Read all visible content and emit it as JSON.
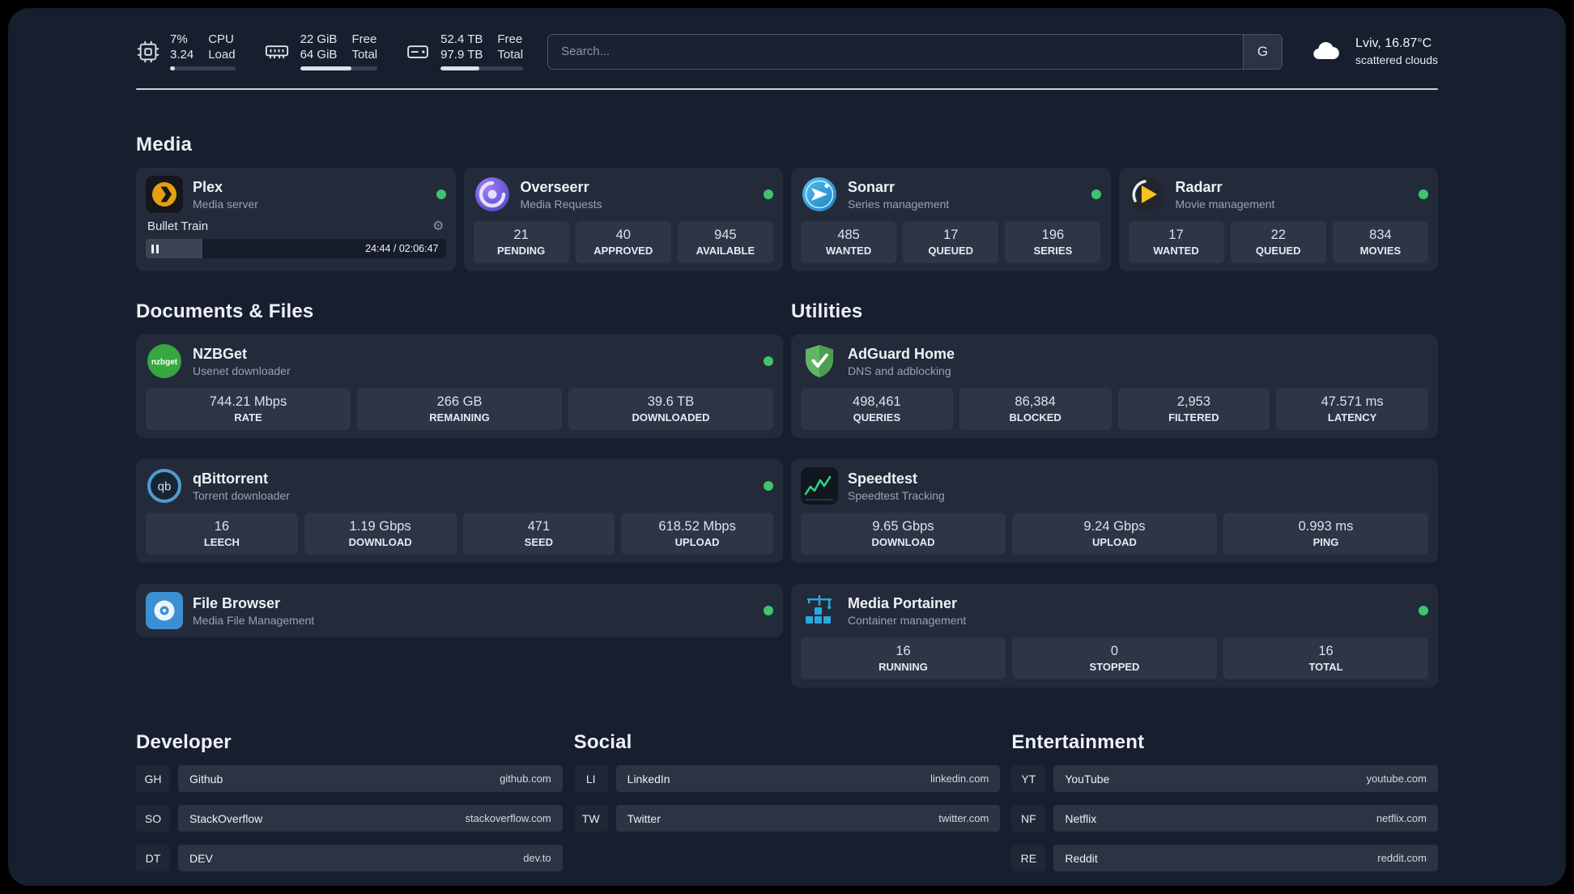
{
  "topbar": {
    "system": [
      {
        "icon": "cpu-icon",
        "rows": [
          [
            "7%",
            "CPU"
          ],
          [
            "3.24",
            "Load"
          ]
        ],
        "progress": 7
      },
      {
        "icon": "ram-icon",
        "rows": [
          [
            "22 GiB",
            "Free"
          ],
          [
            "64 GiB",
            "Total"
          ]
        ],
        "progress": 66
      },
      {
        "icon": "disk-icon",
        "rows": [
          [
            "52.4 TB",
            "Free"
          ],
          [
            "97.9 TB",
            "Total"
          ]
        ],
        "progress": 47
      }
    ],
    "search": {
      "placeholder": "Search...",
      "engine_button": "G"
    },
    "weather": {
      "location": "Lviv, 16.87°C",
      "condition": "scattered clouds"
    }
  },
  "media": {
    "title": "Media",
    "apps": [
      {
        "id": "plex",
        "icon": "plex-icon",
        "name": "Plex",
        "subtitle": "Media server",
        "status": true,
        "player": {
          "title": "Bullet Train",
          "time": "24:44 / 02:06:47",
          "progress": 19
        }
      },
      {
        "id": "overseerr",
        "icon": "overseerr-icon",
        "name": "Overseerr",
        "subtitle": "Media Requests",
        "status": true,
        "stats": [
          {
            "value": "21",
            "label": "PENDING"
          },
          {
            "value": "40",
            "label": "APPROVED"
          },
          {
            "value": "945",
            "label": "AVAILABLE"
          }
        ]
      },
      {
        "id": "sonarr",
        "icon": "sonarr-icon",
        "name": "Sonarr",
        "subtitle": "Series management",
        "status": true,
        "stats": [
          {
            "value": "485",
            "label": "WANTED"
          },
          {
            "value": "17",
            "label": "QUEUED"
          },
          {
            "value": "196",
            "label": "SERIES"
          }
        ]
      },
      {
        "id": "radarr",
        "icon": "radarr-icon",
        "name": "Radarr",
        "subtitle": "Movie management",
        "status": true,
        "stats": [
          {
            "value": "17",
            "label": "WANTED"
          },
          {
            "value": "22",
            "label": "QUEUED"
          },
          {
            "value": "834",
            "label": "MOVIES"
          }
        ]
      }
    ]
  },
  "columns": [
    {
      "title": "Documents & Files",
      "apps": [
        {
          "id": "nzbget",
          "icon": "nzbget-icon",
          "name": "NZBGet",
          "subtitle": "Usenet downloader",
          "status": true,
          "stats": [
            {
              "value": "744.21 Mbps",
              "label": "RATE"
            },
            {
              "value": "266 GB",
              "label": "REMAINING"
            },
            {
              "value": "39.6 TB",
              "label": "DOWNLOADED"
            }
          ]
        },
        {
          "id": "qbittorrent",
          "icon": "qbittorrent-icon",
          "name": "qBittorrent",
          "subtitle": "Torrent downloader",
          "status": true,
          "stats": [
            {
              "value": "16",
              "label": "LEECH"
            },
            {
              "value": "1.19 Gbps",
              "label": "DOWNLOAD"
            },
            {
              "value": "471",
              "label": "SEED"
            },
            {
              "value": "618.52 Mbps",
              "label": "UPLOAD"
            }
          ]
        },
        {
          "id": "filebrowser",
          "icon": "filebrowser-icon",
          "name": "File Browser",
          "subtitle": "Media File Management",
          "status": true
        }
      ]
    },
    {
      "title": "Utilities",
      "apps": [
        {
          "id": "adguard",
          "icon": "adguard-icon",
          "name": "AdGuard Home",
          "subtitle": "DNS and adblocking",
          "status": false,
          "stats": [
            {
              "value": "498,461",
              "label": "QUERIES"
            },
            {
              "value": "86,384",
              "label": "BLOCKED"
            },
            {
              "value": "2,953",
              "label": "FILTERED"
            },
            {
              "value": "47.571 ms",
              "label": "LATENCY"
            }
          ]
        },
        {
          "id": "speedtest",
          "icon": "speedtest-icon",
          "name": "Speedtest",
          "subtitle": "Speedtest Tracking",
          "status": false,
          "stats": [
            {
              "value": "9.65 Gbps",
              "label": "DOWNLOAD"
            },
            {
              "value": "9.24 Gbps",
              "label": "UPLOAD"
            },
            {
              "value": "0.993 ms",
              "label": "PING"
            }
          ]
        },
        {
          "id": "portainer",
          "icon": "portainer-icon",
          "name": "Media Portainer",
          "subtitle": "Container management",
          "status": true,
          "stats": [
            {
              "value": "16",
              "label": "RUNNING"
            },
            {
              "value": "0",
              "label": "STOPPED"
            },
            {
              "value": "16",
              "label": "TOTAL"
            }
          ]
        }
      ]
    }
  ],
  "link_sections": [
    {
      "title": "Developer",
      "links": [
        {
          "badge": "GH",
          "name": "Github",
          "domain": "github.com"
        },
        {
          "badge": "SO",
          "name": "StackOverflow",
          "domain": "stackoverflow.com"
        },
        {
          "badge": "DT",
          "name": "DEV",
          "domain": "dev.to"
        }
      ]
    },
    {
      "title": "Social",
      "links": [
        {
          "badge": "LI",
          "name": "LinkedIn",
          "domain": "linkedin.com"
        },
        {
          "badge": "TW",
          "name": "Twitter",
          "domain": "twitter.com"
        }
      ]
    },
    {
      "title": "Entertainment",
      "links": [
        {
          "badge": "YT",
          "name": "YouTube",
          "domain": "youtube.com"
        },
        {
          "badge": "NF",
          "name": "Netflix",
          "domain": "netflix.com"
        },
        {
          "badge": "RE",
          "name": "Reddit",
          "domain": "reddit.com"
        }
      ]
    }
  ],
  "colors": {
    "status_online": "#3ec46d"
  }
}
